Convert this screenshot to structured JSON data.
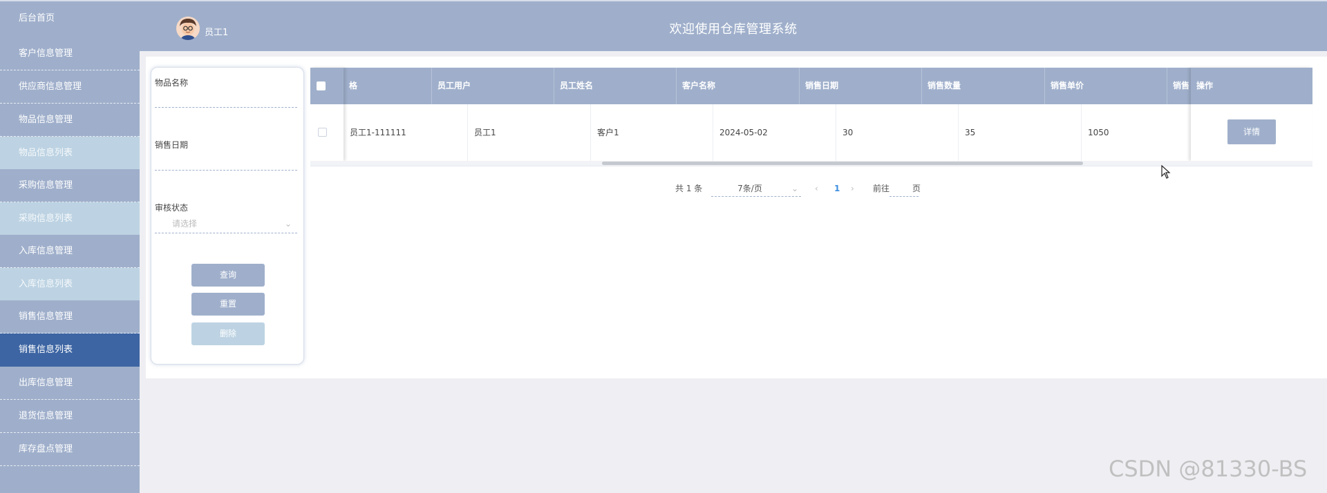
{
  "sidebar": {
    "items": [
      {
        "label": "后台首页"
      },
      {
        "label": "客户信息管理"
      },
      {
        "label": "供应商信息管理"
      },
      {
        "label": "物品信息管理"
      },
      {
        "label": "物品信息列表"
      },
      {
        "label": "采购信息管理"
      },
      {
        "label": "采购信息列表"
      },
      {
        "label": "入库信息管理"
      },
      {
        "label": "入库信息列表"
      },
      {
        "label": "销售信息管理"
      },
      {
        "label": "销售信息列表"
      },
      {
        "label": "出库信息管理"
      },
      {
        "label": "退货信息管理"
      },
      {
        "label": "库存盘点管理"
      }
    ]
  },
  "header": {
    "user_name": "员工1",
    "title": "欢迎使用仓库管理系统"
  },
  "search": {
    "item_name_label": "物品名称",
    "item_name_value": "",
    "sale_date_label": "销售日期",
    "sale_date_value": "",
    "audit_status_label": "审核状态",
    "audit_status_placeholder": "请选择",
    "query_button": "查询",
    "reset_button": "重置",
    "delete_button": "删除"
  },
  "table": {
    "columns": [
      "格",
      "员工用户",
      "员工姓名",
      "客户名称",
      "销售日期",
      "销售数量",
      "销售单价",
      "销售",
      "操作"
    ],
    "rows": [
      {
        "cells": [
          "员工1-111111",
          "员工1",
          "客户1",
          "2024-05-02",
          "30",
          "35",
          "1050"
        ],
        "action": "详情"
      }
    ]
  },
  "pagination": {
    "total": "共 1 条",
    "page_size": "7条/页",
    "prev": "‹",
    "current_page": "1",
    "next": "›",
    "goto_label": "前往",
    "goto_value": "",
    "page_suffix": "页"
  },
  "watermark": "CSDN @81330-BS",
  "colors": {
    "sidebar": "#9fafcb",
    "sidebar_sub": "#bdd3e3",
    "sidebar_active": "#3d65a3",
    "header": "#9fafcb",
    "page_active": "#3d8ee0"
  }
}
